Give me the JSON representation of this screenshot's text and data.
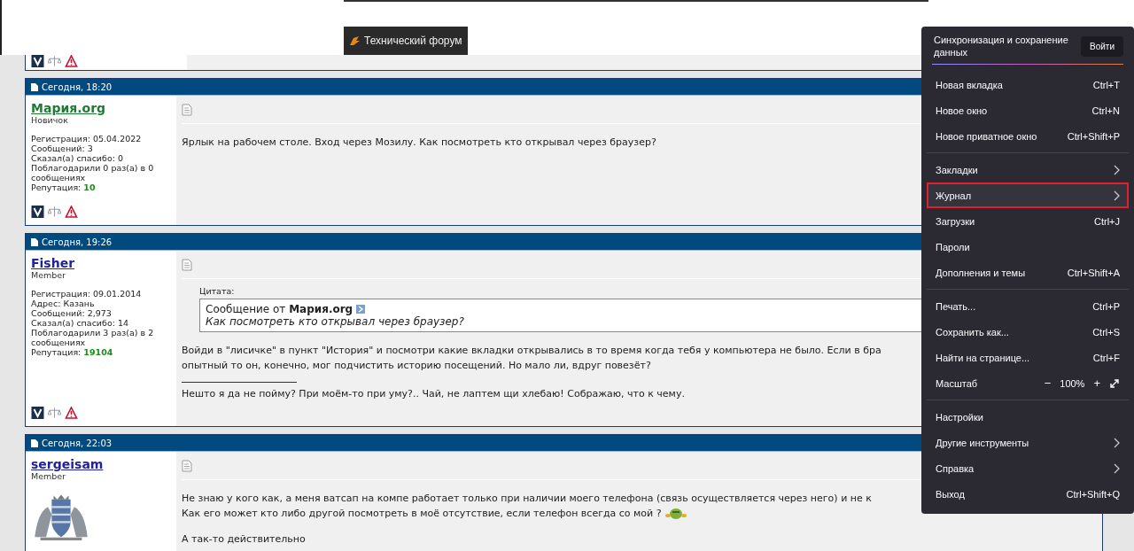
{
  "tab": {
    "title": "Технический форум"
  },
  "posts": [
    {
      "date": "Сегодня, 18:20",
      "author": "Мария.org",
      "color": "#1e7b34",
      "rank": "Новичок",
      "has_avatar": false,
      "stats": [
        "Регистрация: 05.04.2022",
        "Сообщений: 3",
        "Сказал(а) спасибо: 0",
        "Поблагодарили 0 раз(а) в 0 сообщениях"
      ],
      "reputation": {
        "label": "Репутация:",
        "value": "10"
      },
      "show_footer": true,
      "blocks": [
        {
          "kind": "text",
          "lines": [
            {
              "text": "Ярлык на рабочем столе. Вход через Мозилу. Как посмотреть кто открывал через браузер?",
              "emoticon": false
            }
          ]
        }
      ]
    },
    {
      "date": "Сегодня, 19:26",
      "author": "Fisher",
      "color": "#22229c",
      "rank": "Member",
      "has_avatar": false,
      "stats": [
        "Регистрация: 09.01.2014",
        "Адрес: Казань",
        "Сообщений: 2,973",
        "Сказал(а) спасибо: 14",
        "Поблагодарили 3 раз(а) в 2 сообщениях"
      ],
      "reputation": {
        "label": "Репутация:",
        "value": "19104"
      },
      "show_footer": true,
      "blocks": [
        {
          "kind": "quote",
          "label": "Цитата:",
          "from": "Сообщение от **Мария.org**",
          "text": "Как посмотреть кто открывал через браузер?"
        },
        {
          "kind": "text",
          "lines": [
            {
              "text": "Войди в \"лисичке\" в пункт \"История\" и посмотри какие вкладки открывались в то время когда тебя у компьютера не было. Если в бра",
              "emoticon": false
            },
            {
              "text": "опытный то он, конечно, мог подчистить историю посещений. Но мало ли, вдруг повезёт?",
              "emoticon": false
            }
          ]
        },
        {
          "kind": "signature",
          "text": "Нешто я да не пойму? При моём-то при уму?.. Чай, не лаптем щи хлебаю! Сображаю, что к чему."
        }
      ]
    },
    {
      "date": "Сегодня, 22:03",
      "author": "sergeisam",
      "color": "#22229c",
      "rank": "Member",
      "has_avatar": true,
      "show_footer": false,
      "blocks": [
        {
          "kind": "text",
          "lines": [
            {
              "text": "Не знаю у кого как, а меня ватсап на компе работает только при наличии моего телефона (связь осуществляется через него) и не к",
              "emoticon": false
            },
            {
              "text": "Как его может кто либо другой посмотреть в моё отсутствие, если телефон всегда со мой ?",
              "emoticon": true
            }
          ]
        },
        {
          "kind": "text",
          "lines": [
            {
              "text": "А так-то действительно",
              "emoticon": false
            }
          ]
        }
      ]
    }
  ],
  "menu": {
    "sync": {
      "text": "Синхронизация и сохранение данных",
      "button": "Войти"
    },
    "groups": [
      [
        {
          "kind": "shortcut",
          "label": "Новая вкладка",
          "shortcut": "Ctrl+T",
          "selected": false
        },
        {
          "kind": "shortcut",
          "label": "Новое окно",
          "shortcut": "Ctrl+N",
          "selected": false
        },
        {
          "kind": "shortcut",
          "label": "Новое приватное окно",
          "shortcut": "Ctrl+Shift+P",
          "selected": false
        }
      ],
      [
        {
          "kind": "submenu",
          "label": "Закладки",
          "selected": false
        },
        {
          "kind": "submenu",
          "label": "Журнал",
          "selected": true
        },
        {
          "kind": "shortcut",
          "label": "Загрузки",
          "shortcut": "Ctrl+J",
          "selected": false
        },
        {
          "kind": "plain",
          "label": "Пароли",
          "selected": false
        },
        {
          "kind": "shortcut",
          "label": "Дополнения и темы",
          "shortcut": "Ctrl+Shift+A",
          "selected": false
        }
      ],
      [
        {
          "kind": "shortcut",
          "label": "Печать...",
          "shortcut": "Ctrl+P",
          "selected": false
        },
        {
          "kind": "shortcut",
          "label": "Сохранить как...",
          "shortcut": "Ctrl+S",
          "selected": false
        },
        {
          "kind": "shortcut",
          "label": "Найти на странице...",
          "shortcut": "Ctrl+F",
          "selected": false
        },
        {
          "kind": "zoom",
          "label": "Масштаб",
          "minus": "−",
          "value": "100%",
          "plus": "+",
          "selected": false
        }
      ],
      [
        {
          "kind": "plain",
          "label": "Настройки",
          "selected": false
        },
        {
          "kind": "submenu",
          "label": "Другие инструменты",
          "selected": false
        },
        {
          "kind": "submenu",
          "label": "Справка",
          "selected": false
        },
        {
          "kind": "shortcut",
          "label": "Выход",
          "shortcut": "Ctrl+Shift+Q",
          "selected": false
        }
      ]
    ]
  }
}
